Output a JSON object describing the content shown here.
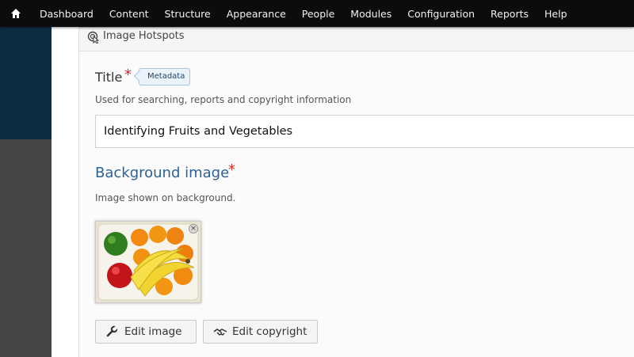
{
  "toolbar": {
    "home_icon": "home-icon",
    "items": [
      "Dashboard",
      "Content",
      "Structure",
      "Appearance",
      "People",
      "Modules",
      "Configuration",
      "Reports",
      "Help"
    ]
  },
  "panel": {
    "header": "Image Hotspots",
    "header_icon": "hotspot-pointer-icon"
  },
  "title_field": {
    "label": "Title",
    "required_mark": "*",
    "tag": "Metadata",
    "description": "Used for searching, reports and copyright information",
    "value": "Identifying Fruits and Vegetables"
  },
  "background_field": {
    "label": "Background image",
    "required_mark": "*",
    "description": "Image shown on background.",
    "remove_label": "×"
  },
  "buttons": {
    "edit_image": "Edit image",
    "edit_copyright": "Edit copyright"
  },
  "colors": {
    "toolbar_bg": "#0c0c0c",
    "sidebar_dark": "#0c2c42",
    "link_blue": "#2e6193",
    "required_red": "#d52727"
  }
}
